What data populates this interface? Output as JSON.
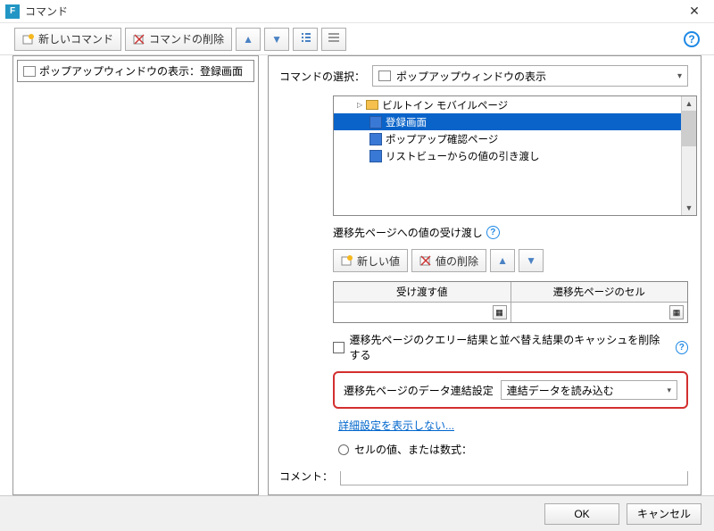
{
  "window": {
    "title": "コマンド"
  },
  "toolbar": {
    "new_command": "新しいコマンド",
    "delete_command": "コマンドの削除"
  },
  "left": {
    "item": "ポップアップウィンドウの表示：登録画面"
  },
  "command_select": {
    "label": "コマンドの選択：",
    "selected": "ポップアップウィンドウの表示"
  },
  "tree": {
    "group": "ビルトイン モバイルページ",
    "items": [
      "登録画面",
      "ポップアップ確認ページ",
      "リストビューからの値の引き渡し"
    ]
  },
  "pass_values": {
    "label": "遷移先ページへの値の受け渡し"
  },
  "values_toolbar": {
    "new_value": "新しい値",
    "delete_value": "値の削除"
  },
  "values_table": {
    "col1": "受け渡す値",
    "col2": "遷移先ページのセル"
  },
  "cache_checkbox": {
    "label": "遷移先ページのクエリー結果と並べ替え結果のキャッシュを削除する"
  },
  "data_link": {
    "label": "遷移先ページのデータ連結設定",
    "value": "連結データを読み込む"
  },
  "advanced_link": "詳細設定を表示しない...",
  "radio_partial": "セルの値、または数式：",
  "comment": {
    "label": "コメント："
  },
  "footer": {
    "ok": "OK",
    "cancel": "キャンセル"
  }
}
